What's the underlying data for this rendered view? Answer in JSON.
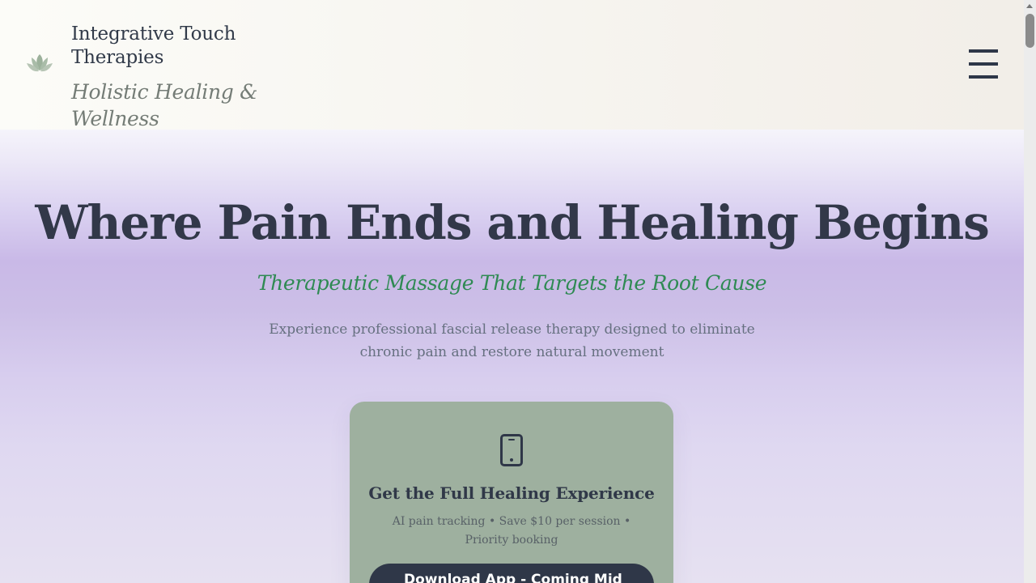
{
  "header": {
    "logo_icon": "lotus-icon",
    "title": "Integrative Touch Therapies",
    "tagline": "Holistic Healing & Wellness",
    "menu_icon": "hamburger-menu-icon"
  },
  "hero": {
    "title": "Where Pain Ends and Healing Begins",
    "subtitle": "Therapeutic Massage That Targets the Root Cause",
    "description": "Experience professional fascial release therapy designed to eliminate chronic pain and restore natural movement"
  },
  "app_card": {
    "icon": "mobile-phone-icon",
    "title": "Get the Full Healing Experience",
    "features": "AI pain tracking • Save $10 per session • Priority booking",
    "button_label": "Download App - Coming Mid"
  },
  "colors": {
    "text_dark": "#2f3748",
    "accent_green": "#2f8a53",
    "card_green": "#9eb09f",
    "hero_purple": "#c9b9e7"
  }
}
